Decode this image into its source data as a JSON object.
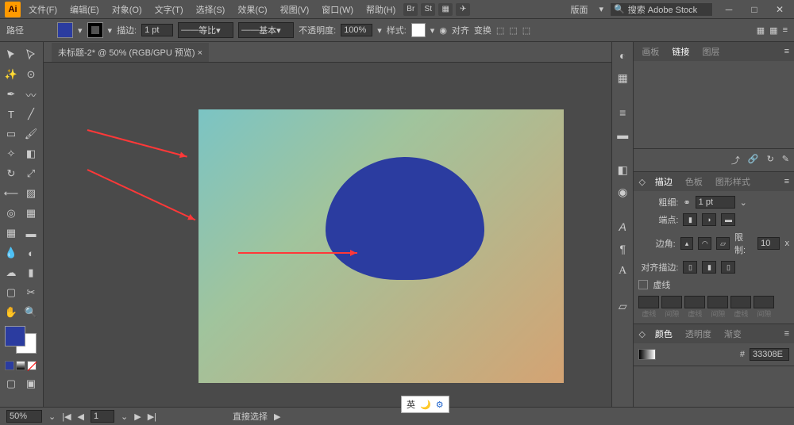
{
  "app": {
    "logo": "Ai"
  },
  "menu": {
    "file": "文件(F)",
    "edit": "编辑(E)",
    "object": "对象(O)",
    "type": "文字(T)",
    "select": "选择(S)",
    "effect": "效果(C)",
    "view": "视图(V)",
    "window": "窗口(W)",
    "help": "帮助(H)"
  },
  "workspace": {
    "label": "版面",
    "search_placeholder": "搜索 Adobe Stock"
  },
  "controlbar": {
    "path": "路径",
    "stroke": "描边:",
    "stroke_val": "1 pt",
    "ratio": "等比",
    "basic": "基本",
    "opacity": "不透明度:",
    "opacity_val": "100%",
    "style": "样式:",
    "align": "对齐",
    "transform": "变换"
  },
  "doc": {
    "tab": "未标题-2* @ 50% (RGB/GPU 预览)"
  },
  "panels": {
    "links_tabs": {
      "artboards": "画板",
      "links": "链接",
      "layers": "图层"
    },
    "stroke_tabs": {
      "stroke": "描边",
      "swatches": "色板",
      "graphic_styles": "图形样式"
    },
    "stroke": {
      "weight": "粗细:",
      "weight_val": "1 pt",
      "cap": "端点:",
      "corner": "边角:",
      "limit": "限制:",
      "limit_val": "10",
      "x": "x",
      "align_stroke": "对齐描边:",
      "dashed": "虚线",
      "dash": "虚线",
      "gap": "间隙"
    },
    "color_tabs": {
      "color": "颜色",
      "opacity": "透明度",
      "gradient": "渐变"
    },
    "color": {
      "hex_label": "#",
      "hex_val": "33308E"
    }
  },
  "status": {
    "zoom": "50%",
    "page": "1",
    "tool": "直接选择"
  },
  "ime": {
    "lang": "英"
  }
}
